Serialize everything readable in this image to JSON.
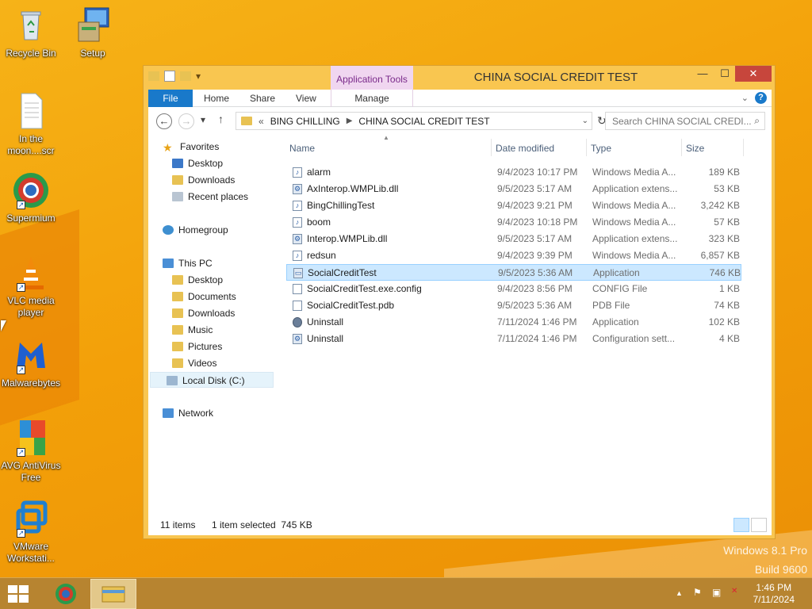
{
  "desktop": {
    "icons": [
      {
        "label": "Recycle Bin",
        "icon": "recycle-bin-icon"
      },
      {
        "label": "Setup",
        "icon": "setup-icon"
      },
      {
        "label": "In the moon....scr",
        "icon": "document-icon"
      },
      {
        "label": "Supermium",
        "icon": "browser-icon"
      },
      {
        "label": "VLC media player",
        "icon": "vlc-cone-icon"
      },
      {
        "label": "Malwarebytes",
        "icon": "malwarebytes-icon"
      },
      {
        "label": "AVG AntiVirus Free",
        "icon": "avg-icon"
      },
      {
        "label": "VMware Workstati...",
        "icon": "vmware-icon"
      }
    ],
    "watermark": {
      "line1": "Windows 8.1 Pro",
      "line2": "Build 9600"
    }
  },
  "window": {
    "title": "CHINA SOCIAL CREDIT TEST",
    "context_tab": "Application Tools",
    "controls": {
      "minimize": "—",
      "maximize": "☐",
      "close": "✕"
    },
    "ribbon_tabs": {
      "file": "File",
      "home": "Home",
      "share": "Share",
      "view": "View",
      "manage": "Manage"
    },
    "nav": {
      "back": "←",
      "forward": "→",
      "recent": "▾",
      "up": "↑",
      "breadcrumb_prefix": "«",
      "breadcrumb": [
        "BING CHILLING",
        "CHINA SOCIAL CREDIT TEST"
      ],
      "search_placeholder": "Search CHINA SOCIAL CREDI..."
    },
    "nav_pane": {
      "favorites": "Favorites",
      "favorites_items": [
        "Desktop",
        "Downloads",
        "Recent places"
      ],
      "homegroup": "Homegroup",
      "this_pc": "This PC",
      "pc_items": [
        "Desktop",
        "Documents",
        "Downloads",
        "Music",
        "Pictures",
        "Videos",
        "Local Disk (C:)"
      ],
      "network": "Network"
    },
    "columns": {
      "name": "Name",
      "date": "Date modified",
      "type": "Type",
      "size": "Size"
    },
    "files": [
      {
        "name": "alarm",
        "date": "9/4/2023 10:17 PM",
        "type": "Windows Media A...",
        "size": "189 KB",
        "icon": "audio-file-icon"
      },
      {
        "name": "AxInterop.WMPLib.dll",
        "date": "9/5/2023 5:17 AM",
        "type": "Application extens...",
        "size": "53 KB",
        "icon": "dll-file-icon"
      },
      {
        "name": "BingChillingTest",
        "date": "9/4/2023 9:21 PM",
        "type": "Windows Media A...",
        "size": "3,242 KB",
        "icon": "audio-file-icon"
      },
      {
        "name": "boom",
        "date": "9/4/2023 10:18 PM",
        "type": "Windows Media A...",
        "size": "57 KB",
        "icon": "audio-file-icon"
      },
      {
        "name": "Interop.WMPLib.dll",
        "date": "9/5/2023 5:17 AM",
        "type": "Application extens...",
        "size": "323 KB",
        "icon": "dll-file-icon"
      },
      {
        "name": "redsun",
        "date": "9/4/2023 9:39 PM",
        "type": "Windows Media A...",
        "size": "6,857 KB",
        "icon": "audio-file-icon"
      },
      {
        "name": "SocialCreditTest",
        "date": "9/5/2023 5:36 AM",
        "type": "Application",
        "size": "746 KB",
        "icon": "application-icon",
        "selected": true
      },
      {
        "name": "SocialCreditTest.exe.config",
        "date": "9/4/2023 8:56 PM",
        "type": "CONFIG File",
        "size": "1 KB",
        "icon": "blank-file-icon"
      },
      {
        "name": "SocialCreditTest.pdb",
        "date": "9/5/2023 5:36 AM",
        "type": "PDB File",
        "size": "74 KB",
        "icon": "blank-file-icon"
      },
      {
        "name": "Uninstall",
        "date": "7/11/2024 1:46 PM",
        "type": "Application",
        "size": "102 KB",
        "icon": "uninstall-gear-icon"
      },
      {
        "name": "Uninstall",
        "date": "7/11/2024 1:46 PM",
        "type": "Configuration sett...",
        "size": "4 KB",
        "icon": "config-file-icon"
      }
    ],
    "status": {
      "count": "11 items",
      "selection": "1 item selected  745 KB"
    }
  },
  "taskbar": {
    "clock_time": "1:46 PM",
    "clock_date": "7/11/2024",
    "tray": {
      "chevron": "▲",
      "flag": "⚑",
      "network": "▣",
      "volume": "✕"
    }
  },
  "colors": {
    "accent": "#1979ca",
    "selection": "#cce8ff",
    "context_tab": "#f0d6f0",
    "taskbar": "#b78430"
  }
}
